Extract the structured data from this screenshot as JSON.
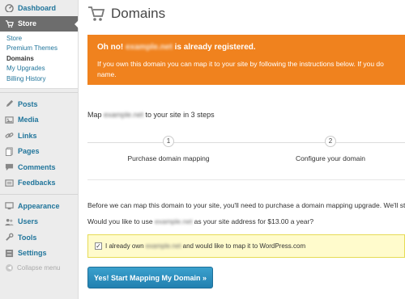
{
  "sidebar": {
    "items_top": [
      {
        "label": "Dashboard",
        "icon": "dashboard-icon"
      }
    ],
    "store": {
      "label": "Store",
      "icon": "store-icon"
    },
    "store_submenu": [
      {
        "label": "Store"
      },
      {
        "label": "Premium Themes"
      },
      {
        "label": "Domains"
      },
      {
        "label": "My Upgrades"
      },
      {
        "label": "Billing History"
      }
    ],
    "items_mid": [
      {
        "label": "Posts",
        "icon": "posts-icon"
      },
      {
        "label": "Media",
        "icon": "media-icon"
      },
      {
        "label": "Links",
        "icon": "links-icon"
      },
      {
        "label": "Pages",
        "icon": "pages-icon"
      },
      {
        "label": "Comments",
        "icon": "comments-icon"
      },
      {
        "label": "Feedbacks",
        "icon": "feedbacks-icon"
      }
    ],
    "items_bottom": [
      {
        "label": "Appearance",
        "icon": "appearance-icon"
      },
      {
        "label": "Users",
        "icon": "users-icon"
      },
      {
        "label": "Tools",
        "icon": "tools-icon"
      },
      {
        "label": "Settings",
        "icon": "settings-icon"
      }
    ],
    "collapse_label": "Collapse menu"
  },
  "page": {
    "title": "Domains",
    "title_icon": "cart-icon"
  },
  "alert": {
    "prefix": "Oh no! ",
    "domain": "example.net",
    "suffix": " is already registered.",
    "body_line1": "If you own this domain you can map it to your site by following the instructions below. If you do",
    "body_line2": "name."
  },
  "steps": {
    "intro_prefix": "Map ",
    "intro_domain": "example.net",
    "intro_suffix": " to your site in 3 steps",
    "items": [
      {
        "num": "1",
        "label": "Purchase domain mapping"
      },
      {
        "num": "2",
        "label": "Configure your domain"
      }
    ]
  },
  "content": {
    "para1": "Before we can map this domain to your site, you'll need to purchase a domain mapping upgrade. We'll still",
    "para2_prefix": "Would you like to use ",
    "para2_domain": "example.net",
    "para2_suffix": " as your site address for $13.00 a year?",
    "own_prefix": "I already own ",
    "own_domain": "example.net",
    "own_suffix": " and would like to map it to WordPress.com",
    "own_checked": true,
    "button_label": "Yes! Start Mapping My Domain »"
  },
  "colors": {
    "alert_bg": "#f0821e",
    "button_bg": "#2e8fbd",
    "link": "#21759b",
    "notice_bg": "#fffbcc"
  }
}
